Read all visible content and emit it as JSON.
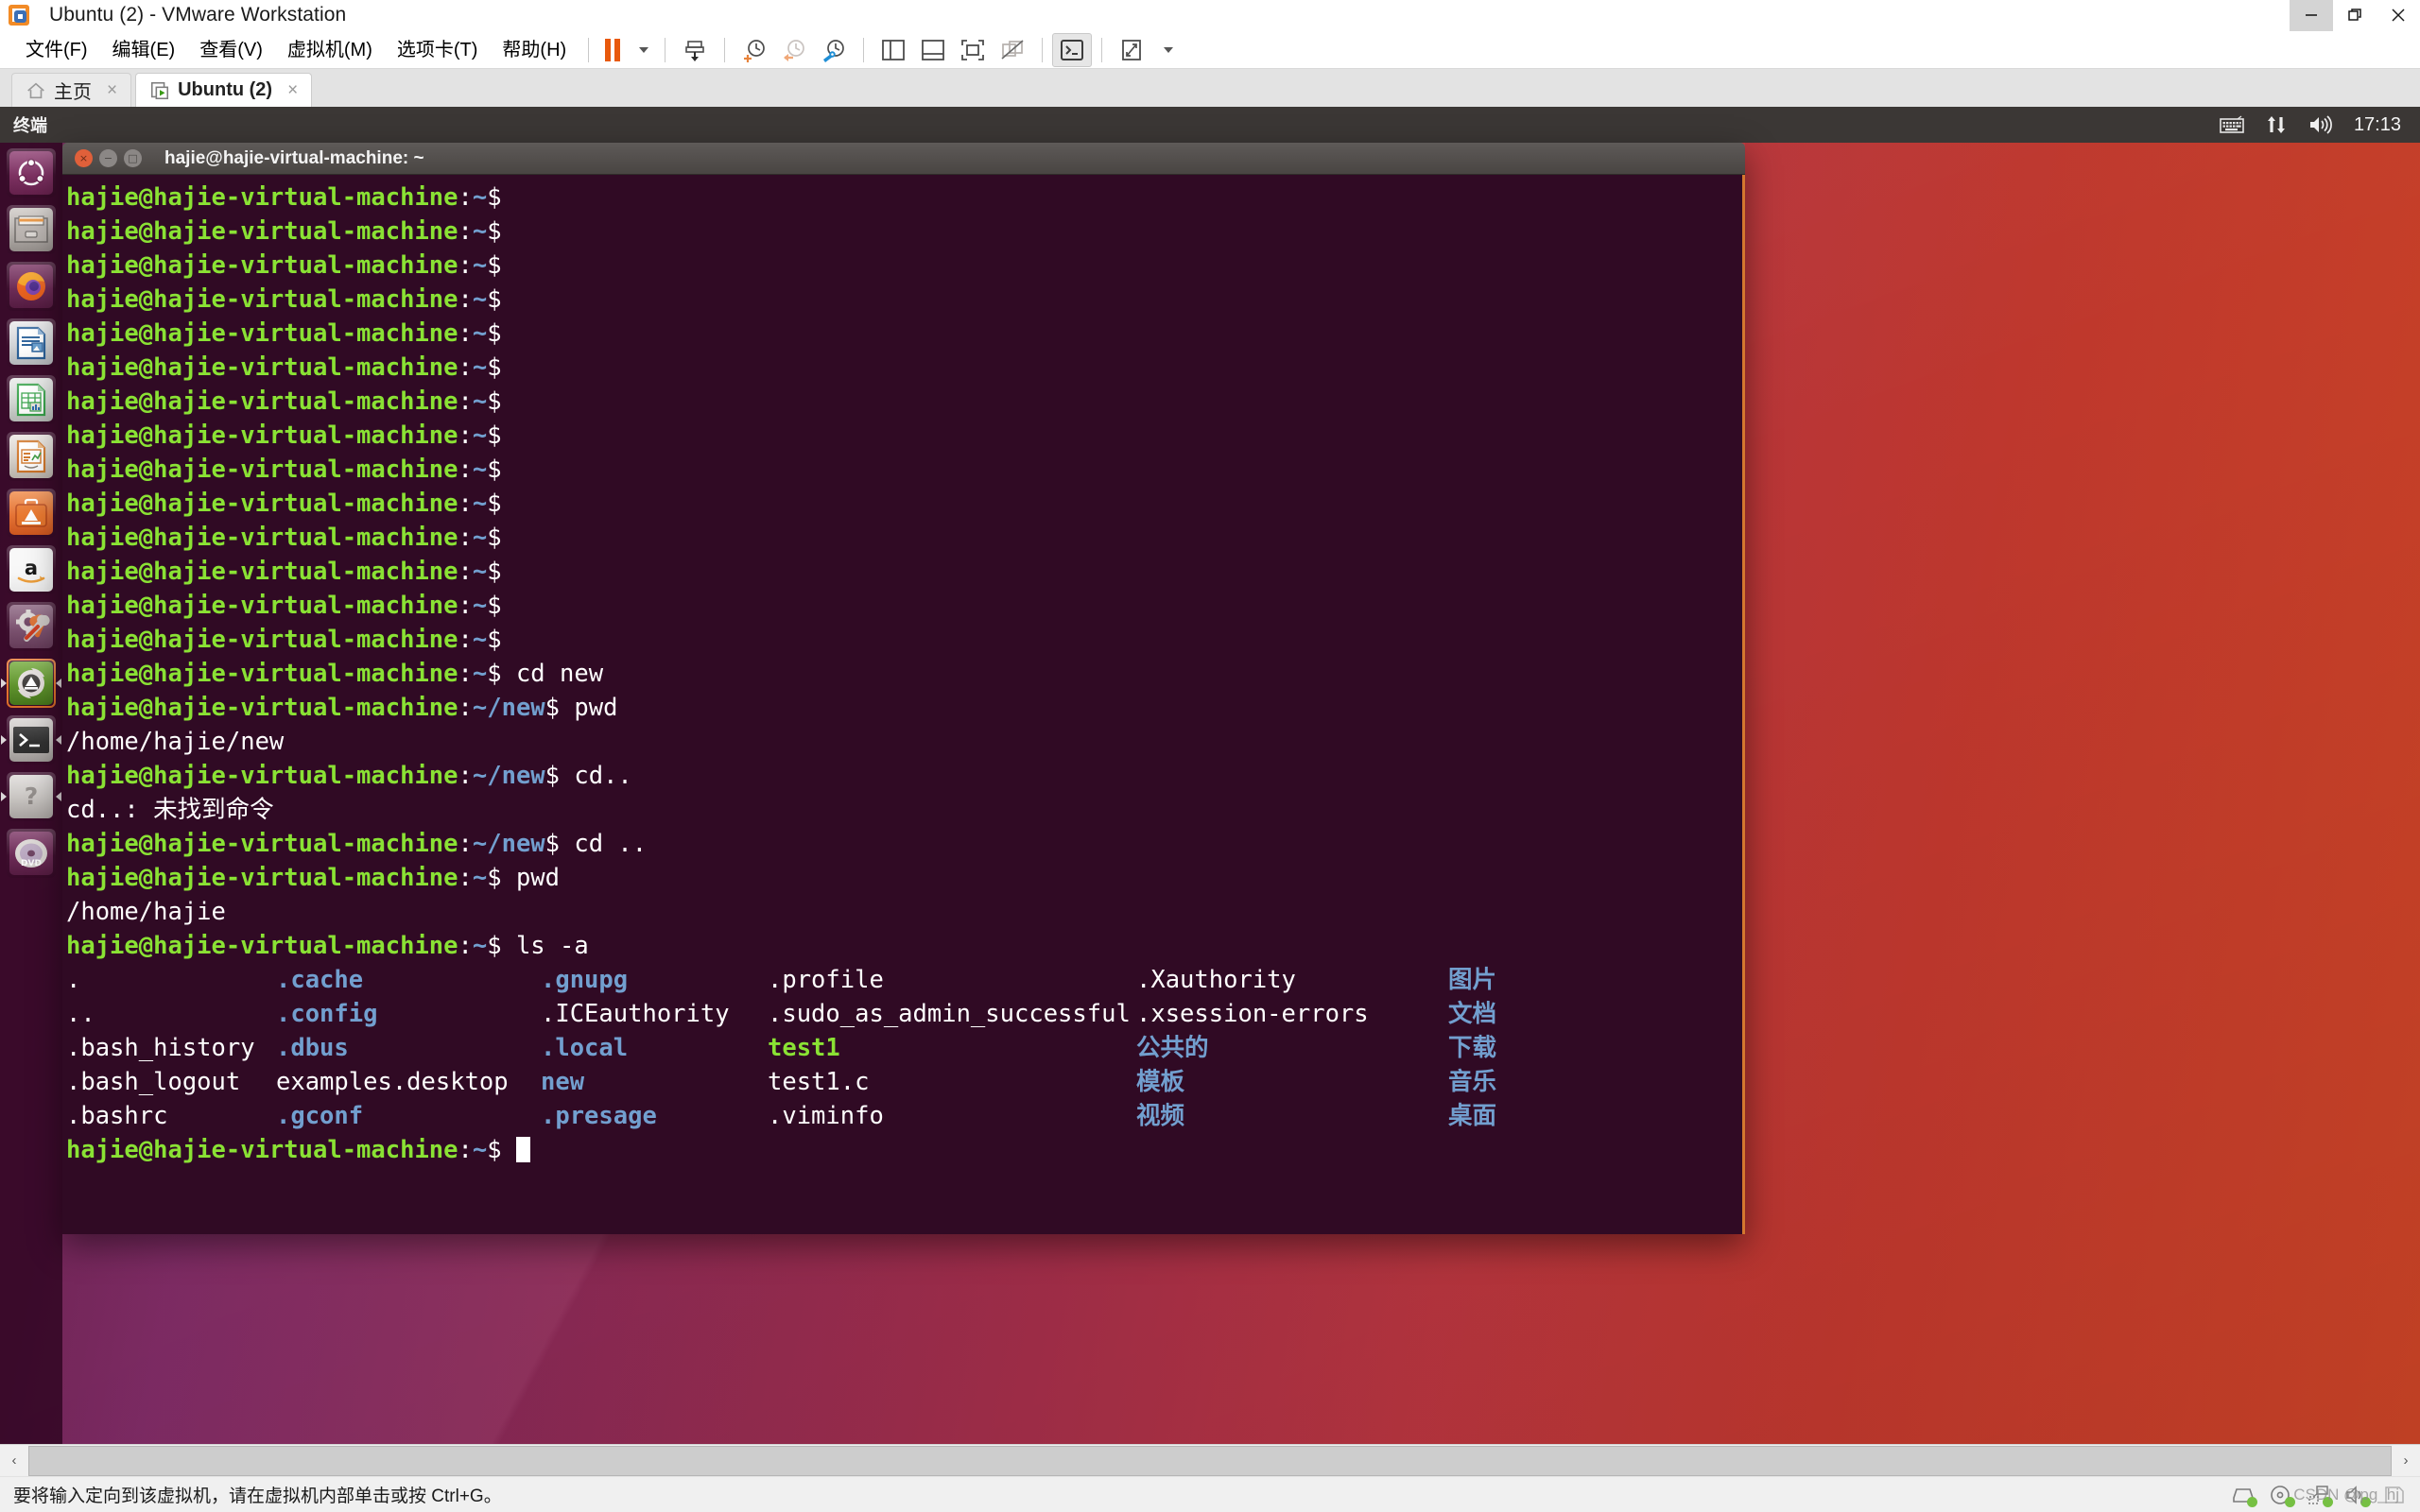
{
  "window": {
    "title": "Ubuntu (2) - VMware Workstation",
    "logo_icon": "vmware-logo-icon",
    "controls": {
      "minimize": "minimize-icon",
      "restore": "restore-icon",
      "close": "close-icon"
    }
  },
  "menubar": {
    "items": [
      {
        "label": "文件(F)",
        "name": "menu-file"
      },
      {
        "label": "编辑(E)",
        "name": "menu-edit"
      },
      {
        "label": "查看(V)",
        "name": "menu-view"
      },
      {
        "label": "虚拟机(M)",
        "name": "menu-vm"
      },
      {
        "label": "选项卡(T)",
        "name": "menu-tabs"
      },
      {
        "label": "帮助(H)",
        "name": "menu-help"
      }
    ],
    "toolbar": [
      {
        "name": "suspend-button",
        "icon": "pause-icon"
      },
      {
        "name": "suspend-dropdown",
        "icon": "chevron-down-icon"
      },
      {
        "name": "power-button",
        "icon": "power-down-icon"
      },
      {
        "name": "take-snapshot-button",
        "icon": "snapshot-add-icon"
      },
      {
        "name": "revert-snapshot-button",
        "icon": "snapshot-revert-icon"
      },
      {
        "name": "snapshot-manager-button",
        "icon": "snapshot-manager-icon"
      },
      {
        "name": "show-sidebar-button",
        "icon": "sidebar-panel-icon"
      },
      {
        "name": "show-thumbnail-bar-button",
        "icon": "bottom-panel-icon"
      },
      {
        "name": "fullscreen-button",
        "icon": "fullscreen-icon"
      },
      {
        "name": "unity-mode-button",
        "icon": "unity-mode-off-icon"
      },
      {
        "name": "console-view-button",
        "icon": "console-icon"
      },
      {
        "name": "stretch-guest-button",
        "icon": "stretch-icon"
      },
      {
        "name": "stretch-dropdown",
        "icon": "chevron-down-icon"
      }
    ]
  },
  "tabs": [
    {
      "label": "主页",
      "icon": "home-icon",
      "close": "×",
      "active": false,
      "name": "tab-home"
    },
    {
      "label": "Ubuntu (2)",
      "icon": "vm-running-icon",
      "close": "×",
      "active": true,
      "name": "tab-ubuntu-2"
    }
  ],
  "guest": {
    "panel": {
      "app_menu": "终端",
      "indicators": [
        {
          "name": "keyboard-indicator-icon",
          "icon": "keyboard-icon"
        },
        {
          "name": "network-indicator-icon",
          "icon": "network-up-down-icon"
        },
        {
          "name": "volume-indicator-icon",
          "icon": "speaker-icon"
        }
      ],
      "clock": "17:13",
      "session_menu_icon": "chevron-up-icon"
    },
    "launcher": [
      {
        "name": "launcher-dash-home",
        "icon": "ubuntu-dash-icon",
        "color": "#772953",
        "running": false,
        "focused": false
      },
      {
        "name": "launcher-files",
        "icon": "file-manager-icon",
        "color": "#8a8480",
        "running": false,
        "focused": false
      },
      {
        "name": "launcher-firefox",
        "icon": "firefox-icon",
        "color": "#6d2f5a",
        "running": false,
        "focused": false
      },
      {
        "name": "launcher-libreoffice-writer",
        "icon": "writer-icon",
        "color": "#2a6099",
        "running": false,
        "focused": false
      },
      {
        "name": "launcher-libreoffice-calc",
        "icon": "calc-icon",
        "color": "#37a24a",
        "running": false,
        "focused": false
      },
      {
        "name": "launcher-libreoffice-impress",
        "icon": "impress-icon",
        "color": "#d0762a",
        "running": false,
        "focused": false
      },
      {
        "name": "launcher-software-center",
        "icon": "software-center-icon",
        "color": "#e2713a",
        "running": false,
        "focused": false
      },
      {
        "name": "launcher-amazon",
        "icon": "amazon-icon",
        "color": "#f4f4f4",
        "running": false,
        "focused": false
      },
      {
        "name": "launcher-system-settings",
        "icon": "gear-wrench-icon",
        "color": "#7c5b70",
        "running": false,
        "focused": false
      },
      {
        "name": "launcher-software-updater",
        "icon": "software-updater-icon",
        "color": "#4e9a06",
        "running": true,
        "focused": true
      },
      {
        "name": "launcher-terminal",
        "icon": "terminal-icon",
        "color": "#3b3b3b",
        "running": true,
        "focused": false
      },
      {
        "name": "launcher-help",
        "icon": "help-icon",
        "color": "#b9b9b9",
        "running": true,
        "focused": false
      },
      {
        "name": "launcher-dvd",
        "icon": "dvd-disc-icon",
        "color": "#6d2f5a",
        "running": false,
        "focused": false
      }
    ],
    "terminal": {
      "title": "hajie@hajie-virtual-machine: ~",
      "buttons": {
        "close": "×",
        "minimize": "−",
        "maximize": "□"
      },
      "prompt_user_host": "hajie@hajie-virtual-machine",
      "prompt_home": ":~$",
      "prompt_new": ":~/new$",
      "empty_prompt_count": 14,
      "lines": [
        {
          "type": "prompt",
          "path": "~",
          "command": " cd new"
        },
        {
          "type": "prompt",
          "path": "~/new",
          "command": " pwd"
        },
        {
          "type": "output",
          "text": "/home/hajie/new"
        },
        {
          "type": "prompt",
          "path": "~/new",
          "command": " cd.."
        },
        {
          "type": "output",
          "text": "cd..: 未找到命令"
        },
        {
          "type": "prompt",
          "path": "~/new",
          "command": " cd .."
        },
        {
          "type": "prompt",
          "path": "~",
          "command": " pwd"
        },
        {
          "type": "output",
          "text": "/home/hajie"
        },
        {
          "type": "prompt",
          "path": "~",
          "command": " ls -a"
        }
      ],
      "ls_output": {
        "columns": [
          [
            {
              "text": ".",
              "kind": "plain"
            },
            {
              "text": "..",
              "kind": "plain"
            },
            {
              "text": ".bash_history",
              "kind": "plain"
            },
            {
              "text": ".bash_logout",
              "kind": "plain"
            },
            {
              "text": ".bashrc",
              "kind": "plain"
            }
          ],
          [
            {
              "text": ".cache",
              "kind": "dir"
            },
            {
              "text": ".config",
              "kind": "dir"
            },
            {
              "text": ".dbus",
              "kind": "dir"
            },
            {
              "text": "examples.desktop",
              "kind": "plain"
            },
            {
              "text": ".gconf",
              "kind": "dir"
            }
          ],
          [
            {
              "text": ".gnupg",
              "kind": "dir"
            },
            {
              "text": ".ICEauthority",
              "kind": "plain"
            },
            {
              "text": ".local",
              "kind": "dir"
            },
            {
              "text": "new",
              "kind": "dir"
            },
            {
              "text": ".presage",
              "kind": "dir"
            }
          ],
          [
            {
              "text": ".profile",
              "kind": "plain"
            },
            {
              "text": ".sudo_as_admin_successful",
              "kind": "plain"
            },
            {
              "text": "test1",
              "kind": "exe"
            },
            {
              "text": "test1.c",
              "kind": "plain"
            },
            {
              "text": ".viminfo",
              "kind": "plain"
            }
          ],
          [
            {
              "text": ".Xauthority",
              "kind": "plain"
            },
            {
              "text": ".xsession-errors",
              "kind": "plain"
            },
            {
              "text": "公共的",
              "kind": "dir"
            },
            {
              "text": "模板",
              "kind": "dir"
            },
            {
              "text": "视频",
              "kind": "dir"
            }
          ],
          [
            {
              "text": "图片",
              "kind": "dir"
            },
            {
              "text": "文档",
              "kind": "dir"
            },
            {
              "text": "下载",
              "kind": "dir"
            },
            {
              "text": "音乐",
              "kind": "dir"
            },
            {
              "text": "桌面",
              "kind": "dir"
            }
          ]
        ]
      },
      "final_prompt_path": "~",
      "cursor": "block"
    }
  },
  "statusbar": {
    "hint": "要将输入定向到该虚拟机，请在虚拟机内部单击或按 Ctrl+G。",
    "devices": [
      {
        "name": "hard-disk-device-icon",
        "icon": "disk-icon"
      },
      {
        "name": "cd-dvd-device-icon",
        "icon": "disc-icon"
      },
      {
        "name": "network-adapter-device-icon",
        "icon": "network-icon"
      },
      {
        "name": "sound-card-device-icon",
        "icon": "speaker-icon"
      },
      {
        "name": "printer-device-icon",
        "icon": "printer-icon"
      }
    ],
    "watermark": "CSDN @pg_hj"
  },
  "scrollbar": {
    "left_arrow": "‹",
    "right_arrow": "›"
  },
  "colors": {
    "vmware_orange": "#e8590c",
    "terminal_bg": "#300a24",
    "terminal_green": "#8ae234",
    "terminal_blue": "#729fcf",
    "ubuntu_panel": "#3b3735",
    "wallpaper_purple": "#77215c",
    "wallpaper_red": "#cf4527"
  }
}
